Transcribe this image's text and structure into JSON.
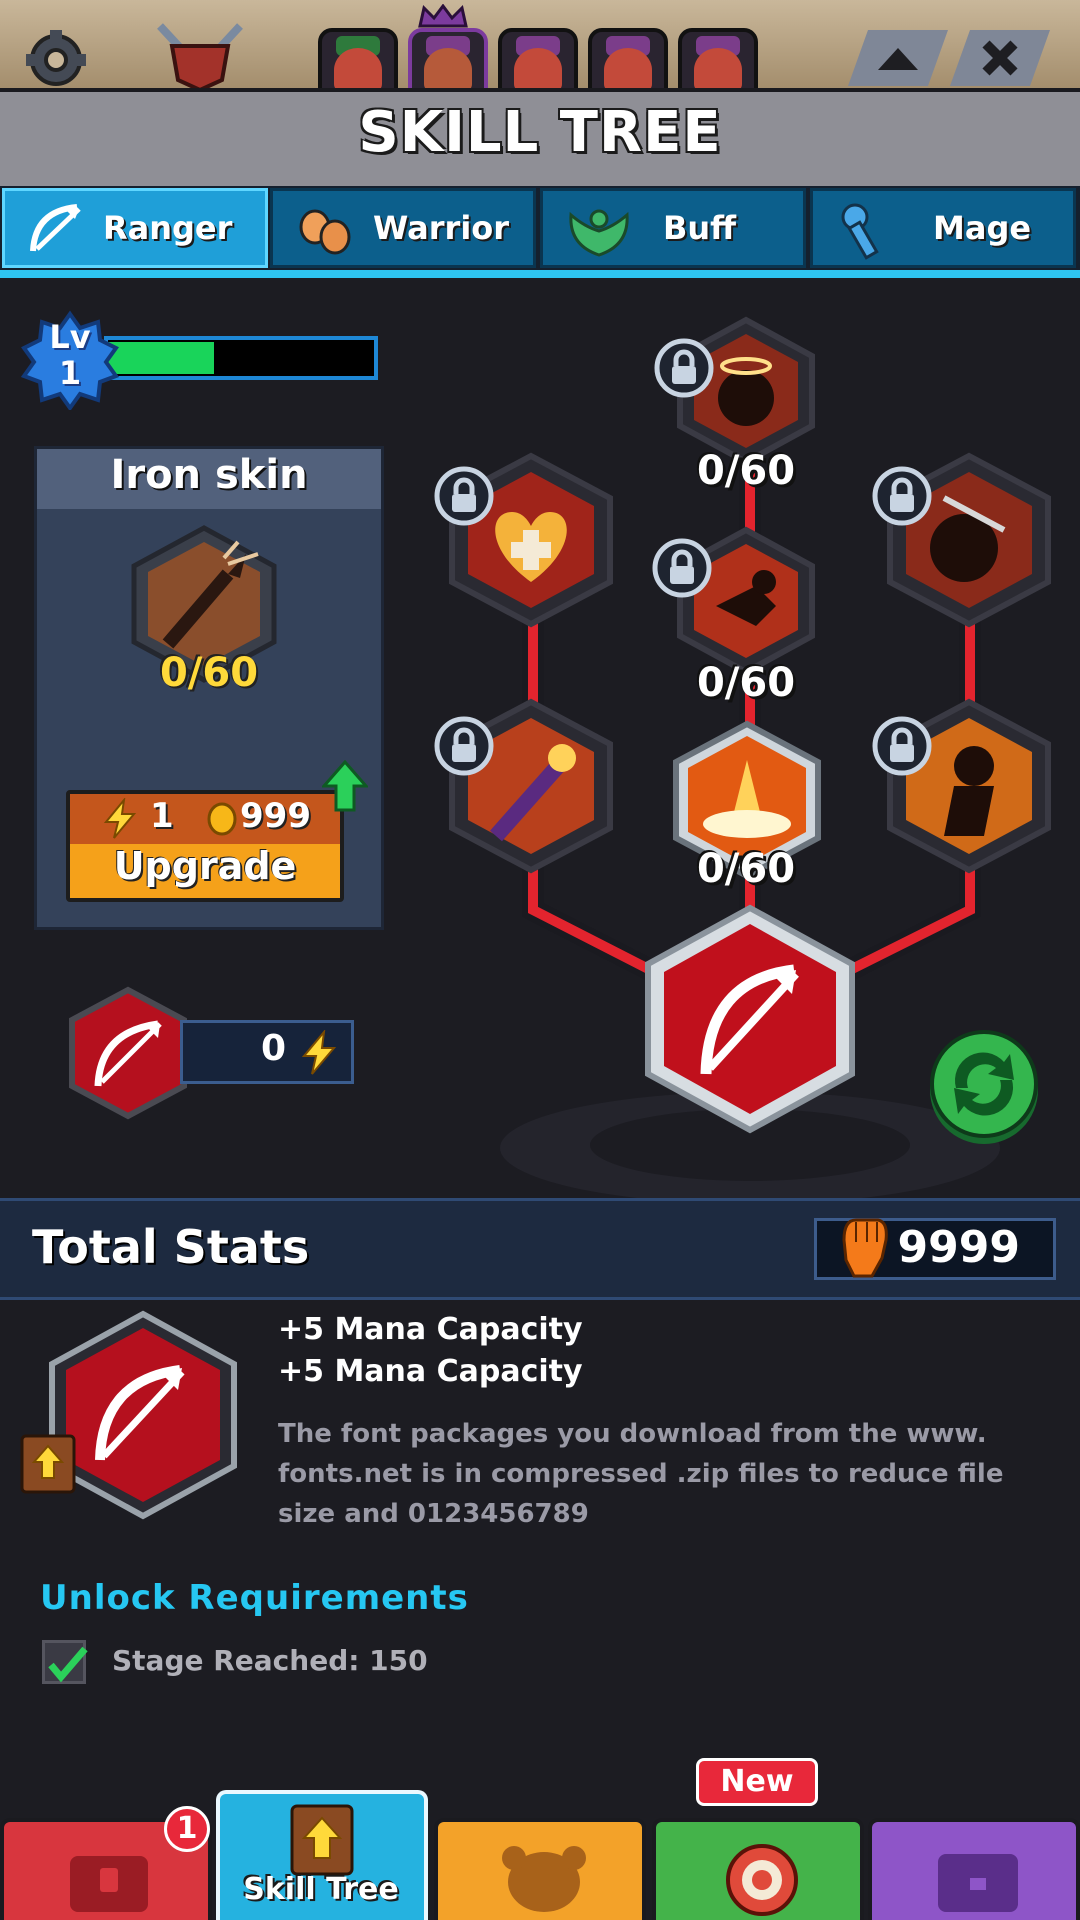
{
  "header": {
    "title": "SKILL TREE"
  },
  "tabs": [
    {
      "label": "Ranger",
      "icon": "bow-icon",
      "active": true
    },
    {
      "label": "Warrior",
      "icon": "fists-icon",
      "active": false
    },
    {
      "label": "Buff",
      "icon": "laurel-icon",
      "active": false
    },
    {
      "label": "Mage",
      "icon": "wrench-icon",
      "active": false
    }
  ],
  "level": {
    "label_lv": "Lv",
    "value": "1",
    "progress": 0.4
  },
  "selected_skill": {
    "name": "Iron skin",
    "progress_text": "0/60",
    "cost_energy": "1",
    "cost_coins": "999",
    "upgrade_label": "Upgrade"
  },
  "energy": {
    "value": "0"
  },
  "skill_nodes": {
    "top_center": "0/60",
    "mid_center": "0/60",
    "low_center": "0/60"
  },
  "total_stats": {
    "title": "Total Stats",
    "power": "9999"
  },
  "details": {
    "line1": "+5 Mana Capacity",
    "line2": "+5 Mana Capacity",
    "description": "The font packages you  download from the  www. fonts.net is in compressed .zip files to reduce file size and 0123456789"
  },
  "requirements": {
    "title": "Unlock Requirements",
    "item": "Stage Reached: 150",
    "met": true
  },
  "bottom_nav": {
    "badge_count": "1",
    "active_label": "Skill Tree",
    "new_tag": "New"
  },
  "colors": {
    "tab_active": "#1f9fd8",
    "accent_red": "#b5101e",
    "gold": "#ffd93a",
    "cyan": "#26c7f2"
  }
}
